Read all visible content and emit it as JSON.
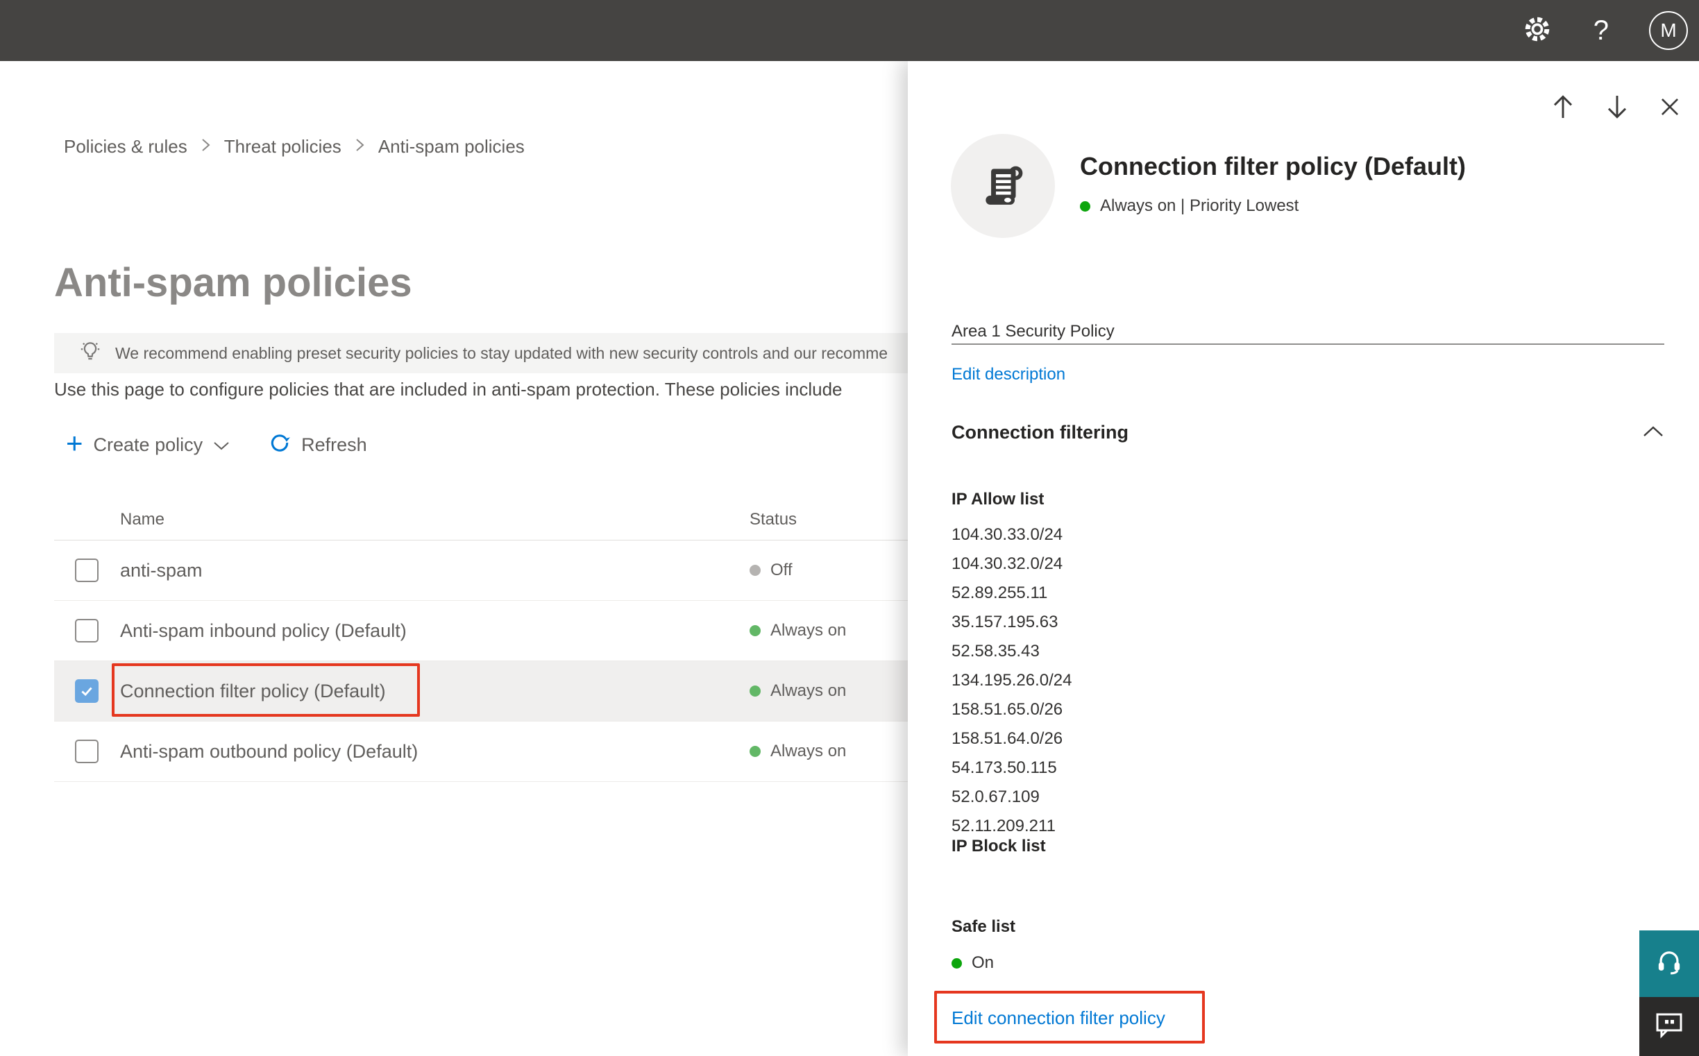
{
  "topbar": {
    "help_label": "?",
    "avatar_initial": "M"
  },
  "breadcrumb": {
    "items": [
      "Policies & rules",
      "Threat policies",
      "Anti-spam policies"
    ]
  },
  "page": {
    "title": "Anti-spam policies",
    "banner_text": "We recommend enabling preset security policies to stay updated with new security controls and our recomme",
    "description": "Use this page to configure policies that are included in anti-spam protection. These policies include"
  },
  "toolbar": {
    "create_policy_label": "Create policy",
    "refresh_label": "Refresh"
  },
  "table": {
    "columns": {
      "name": "Name",
      "status": "Status"
    },
    "rows": [
      {
        "name": "anti-spam",
        "status": "Off",
        "checked": false,
        "selected": false
      },
      {
        "name": "Anti-spam inbound policy (Default)",
        "status": "Always on",
        "checked": false,
        "selected": false
      },
      {
        "name": "Connection filter policy (Default)",
        "status": "Always on",
        "checked": true,
        "selected": true
      },
      {
        "name": "Anti-spam outbound policy (Default)",
        "status": "Always on",
        "checked": false,
        "selected": false
      }
    ]
  },
  "flyout": {
    "title": "Connection filter policy (Default)",
    "status_line": "Always on | Priority Lowest",
    "description": "Area 1 Security Policy",
    "edit_description_label": "Edit description",
    "section_title": "Connection filtering",
    "ip_allow_label": "IP Allow list",
    "ip_allow_list": [
      "104.30.33.0/24",
      "104.30.32.0/24",
      "52.89.255.11",
      "35.157.195.63",
      "52.58.35.43",
      "134.195.26.0/24",
      "158.51.65.0/26",
      "158.51.64.0/26",
      "54.173.50.115",
      "52.0.67.109",
      "52.11.209.211"
    ],
    "ip_block_label": "IP Block list",
    "safe_list_label": "Safe list",
    "safe_list_status": "On",
    "edit_policy_label": "Edit connection filter policy"
  },
  "colors": {
    "accent_blue": "#0078d4",
    "flyout_status_green": "#0ca50c",
    "table_status_green": "#62b766",
    "status_off_gray": "#b5b3b1",
    "annotation_red": "#e5371f",
    "checkbox_blue": "#6aa6e0",
    "support_teal": "#17808c",
    "topbar_dark": "#454442"
  }
}
